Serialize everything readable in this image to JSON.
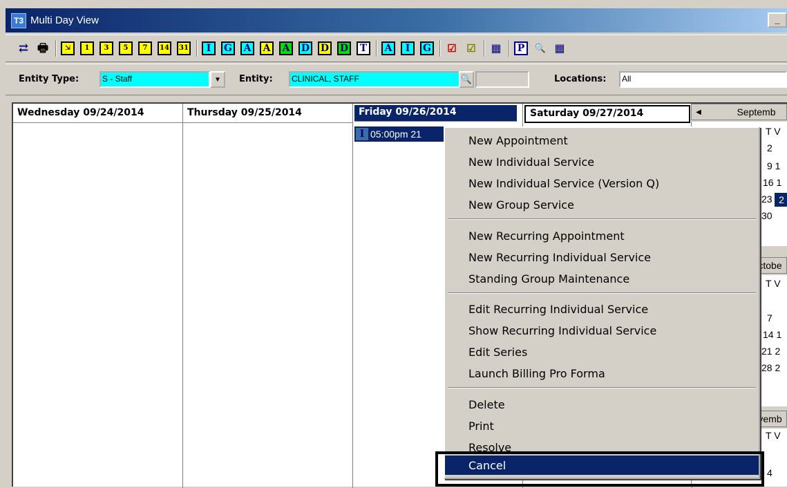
{
  "window": {
    "title": "Multi Day View",
    "icon_label": "T3",
    "title_button_label": "_"
  },
  "toolbar": {
    "refresh_glyph": "⇄",
    "print_glyph": "🖶",
    "number_buttons": [
      "⇲",
      "1",
      "3",
      "5",
      "7",
      "14",
      "31"
    ],
    "letter_buttons": [
      "I",
      "G",
      "A",
      "A",
      "A",
      "D",
      "D",
      "D",
      "T",
      "A",
      "I",
      "G"
    ],
    "check_buttons": [
      "☑",
      "☑"
    ],
    "extra_buttons": [
      "▦",
      "P",
      "🔍",
      "▦"
    ]
  },
  "filters": {
    "entity_type_label": "Entity Type:",
    "entity_type_value": "S - Staff",
    "entity_label": "Entity:",
    "entity_value": "CLINICAL, STAFF",
    "locations_label": "Locations:",
    "locations_value": "All"
  },
  "days": [
    {
      "label": "Wednesday 09/24/2014",
      "selected": false
    },
    {
      "label": "Thursday 09/25/2014",
      "selected": false
    },
    {
      "label": "Friday 09/26/2014",
      "selected": true
    },
    {
      "label": "Saturday 09/27/2014",
      "selected": false
    }
  ],
  "appointment": {
    "type_icon": "I",
    "text": "05:00pm 21"
  },
  "mini_calendar": {
    "sept": {
      "month": "Septemb",
      "dow": "T  V",
      "rows": [
        "2",
        "9  1",
        "16  1",
        "23",
        "30"
      ],
      "selected": "2"
    },
    "oct": {
      "month": "ctobe",
      "dow": "T  V",
      "rows": [
        "7",
        "14  1",
        "21  2",
        "28  2"
      ]
    },
    "nov": {
      "month": "vemb",
      "dow": "T  V",
      "rows": [
        "4"
      ]
    }
  },
  "context_menu": {
    "groups": [
      [
        "New Appointment",
        "New Individual Service",
        "New Individual Service (Version Q)",
        "New Group Service"
      ],
      [
        "New Recurring Appointment",
        "New Recurring Individual Service",
        "Standing Group Maintenance"
      ],
      [
        "Edit Recurring Individual Service",
        "Show Recurring Individual Service",
        "Edit Series",
        "Launch Billing Pro Forma"
      ],
      [
        "Delete",
        "Print",
        "Resolve",
        "Cancel"
      ]
    ],
    "active_item": "Cancel"
  }
}
